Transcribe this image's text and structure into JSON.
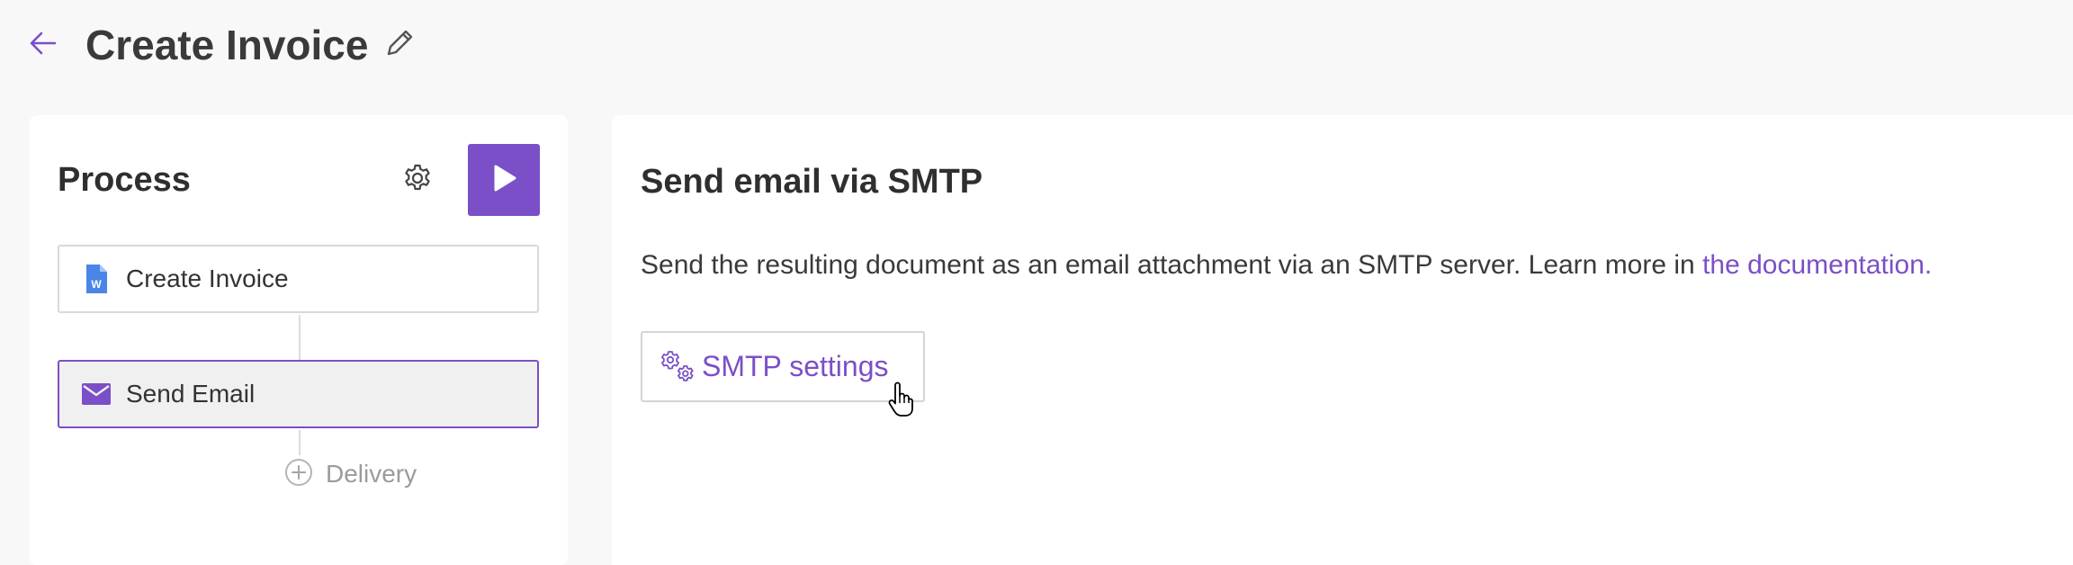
{
  "header": {
    "title": "Create Invoice",
    "back_icon": "arrow-left-icon",
    "edit_icon": "pencil-icon"
  },
  "process_panel": {
    "title": "Process",
    "settings_icon": "gear-icon",
    "run_icon": "play-icon",
    "steps": [
      {
        "label": "Create Invoice",
        "icon": "word-document-icon",
        "selected": false
      },
      {
        "label": "Send Email",
        "icon": "envelope-icon",
        "selected": true
      }
    ],
    "add_delivery_label": "Delivery",
    "add_icon": "plus-circle-icon"
  },
  "detail_panel": {
    "title": "Send email via SMTP",
    "description": "Send the resulting document as an email attachment via an SMTP server. Learn more in ",
    "doc_link_text": "the documentation.",
    "smtp_button_label": "SMTP settings",
    "smtp_button_icon": "gears-icon"
  },
  "colors": {
    "accent": "#7b4fc7",
    "background": "#f8f8f8",
    "panel": "#ffffff",
    "word_blue": "#4a86e8"
  }
}
